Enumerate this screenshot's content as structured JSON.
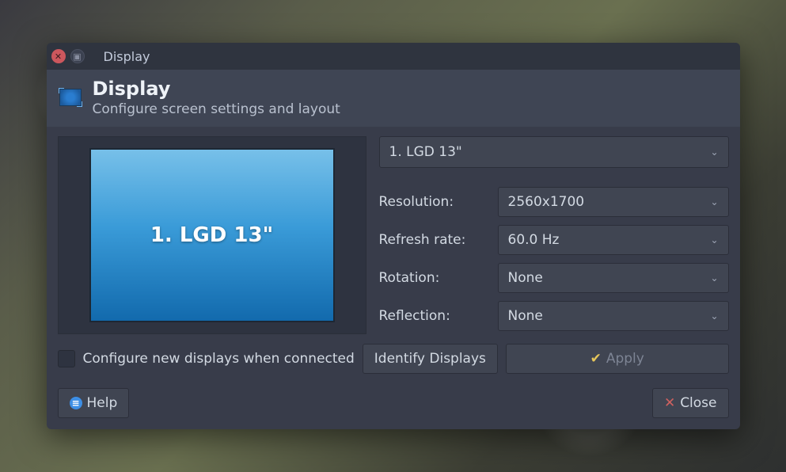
{
  "window": {
    "title": "Display"
  },
  "header": {
    "title": "Display",
    "subtitle": "Configure screen settings and layout"
  },
  "preview": {
    "label": "1. LGD 13\""
  },
  "display_selector": {
    "value": "1. LGD 13\""
  },
  "form": {
    "resolution_label": "Resolution:",
    "resolution_value": "2560x1700",
    "refresh_label": "Refresh rate:",
    "refresh_value": "60.0 Hz",
    "rotation_label": "Rotation:",
    "rotation_value": "None",
    "reflection_label": "Reflection:",
    "reflection_value": "None"
  },
  "options": {
    "configure_new_label": "Configure new displays when connected",
    "identify_label": "Identify Displays",
    "apply_label": "Apply"
  },
  "footer": {
    "help_label": "Help",
    "close_label": "Close"
  }
}
